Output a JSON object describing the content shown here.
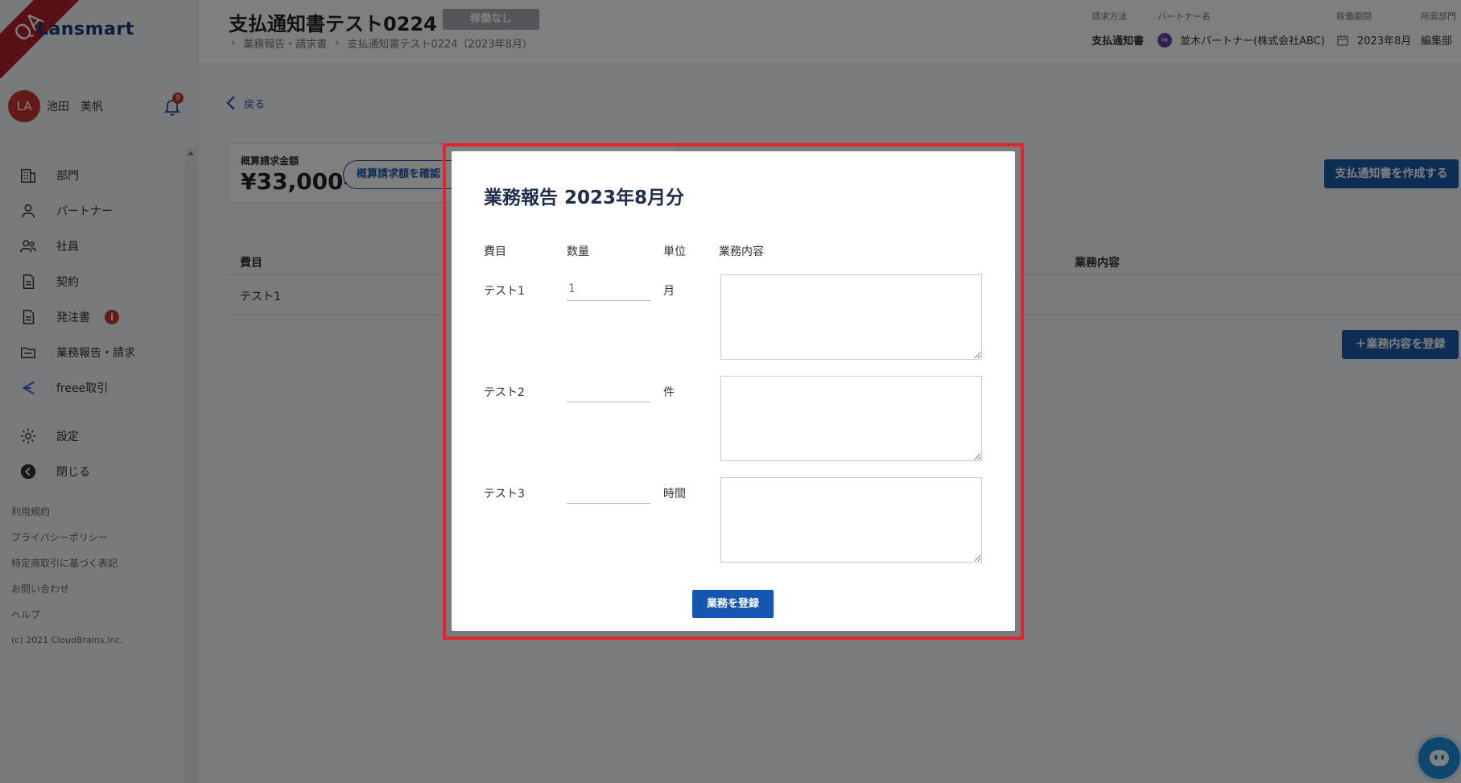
{
  "brand": {
    "logo": "Lansmart",
    "ribbon": "QA"
  },
  "user": {
    "initials": "LA",
    "name": "池田　美帆",
    "notifications": "9"
  },
  "sidebar": {
    "items": [
      {
        "label": "部門",
        "icon": "building-icon"
      },
      {
        "label": "パートナー",
        "icon": "person-icon"
      },
      {
        "label": "社員",
        "icon": "people-icon"
      },
      {
        "label": "契約",
        "icon": "document-icon"
      },
      {
        "label": "発注書",
        "icon": "document-icon",
        "badge": "i"
      },
      {
        "label": "業務報告・請求",
        "icon": "folder-icon"
      },
      {
        "label": "freee取引",
        "icon": "freee-icon"
      }
    ],
    "settings": "設定",
    "close": "閉じる"
  },
  "footer": {
    "terms": "利用規約",
    "privacy": "プライバシーポリシー",
    "commerce": "特定商取引に基づく表記",
    "contact": "お問い合わせ",
    "help": "ヘルプ",
    "copyright": "(c) 2021 CloudBrains,Inc."
  },
  "header": {
    "title": "支払通知書テスト0224",
    "status": "稼働なし",
    "breadcrumb": [
      "業務報告・請求書",
      "支払通知書テスト0224（2023年8月）"
    ],
    "meta": {
      "billing_method_label": "請求方法",
      "billing_method": "支払通知書",
      "partner_label": "パートナー名",
      "partner_initials": "MI",
      "partner": "並木パートナー(株式会社ABC)",
      "period_label": "稼働期間",
      "period": "2023年8月",
      "dept_label": "所属部門",
      "dept": "編集部"
    }
  },
  "main": {
    "back": "戻る",
    "estimate_label": "概算請求金額",
    "estimate_value": "¥33,000-",
    "confirm_button": "概算請求額を確認",
    "create_button": "支払通知書を作成する",
    "table_headers": {
      "item": "費目",
      "content": "業務内容"
    },
    "table_rows": [
      {
        "item": "テスト1"
      }
    ],
    "register_content_button": "＋業務内容を登録"
  },
  "modal": {
    "title": "業務報告 2023年8月分",
    "columns": {
      "item": "費目",
      "qty": "数量",
      "unit": "単位",
      "content": "業務内容"
    },
    "rows": [
      {
        "item": "テスト1",
        "qty": "",
        "qty_placeholder": "1",
        "unit": "月",
        "content": ""
      },
      {
        "item": "テスト2",
        "qty": "",
        "qty_placeholder": "",
        "unit": "件",
        "content": ""
      },
      {
        "item": "テスト3",
        "qty": "",
        "qty_placeholder": "",
        "unit": "時間",
        "content": ""
      }
    ],
    "submit": "業務を登録"
  },
  "colors": {
    "primary": "#1c5aa8",
    "danger": "#c4372c",
    "highlight": "#e0262f"
  }
}
